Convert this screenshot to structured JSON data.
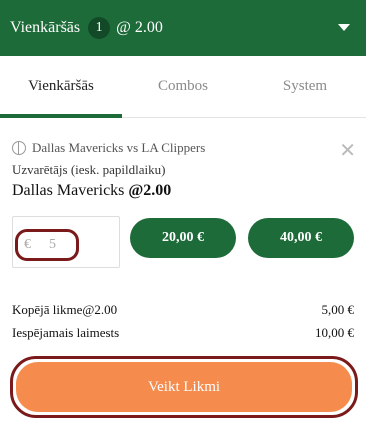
{
  "header": {
    "title": "Vienkāršās",
    "count": "1",
    "odds": "@ 2.00"
  },
  "tabs": [
    {
      "label": "Vienkāršās"
    },
    {
      "label": "Combos"
    },
    {
      "label": "System"
    }
  ],
  "bet": {
    "event": "Dallas Mavericks vs LA Clippers",
    "market": "Uzvarētājs (iesk. papildlaiku)",
    "selection": "Dallas Mavericks",
    "selection_odds": "@2.00",
    "stake_currency": "€",
    "stake_value": "5",
    "quick_stakes": [
      "20,00 €",
      "40,00 €"
    ]
  },
  "summary": {
    "total_label": "Kopējā likme@2.00",
    "total_value": "5,00 €",
    "win_label": "Iespējamais laimests",
    "win_value": "10,00 €"
  },
  "place_bet_label": "Veikt Likmi",
  "colors": {
    "brand": "#1e6b3a",
    "cta": "#f58b4c",
    "highlight": "#7a1a1a"
  }
}
